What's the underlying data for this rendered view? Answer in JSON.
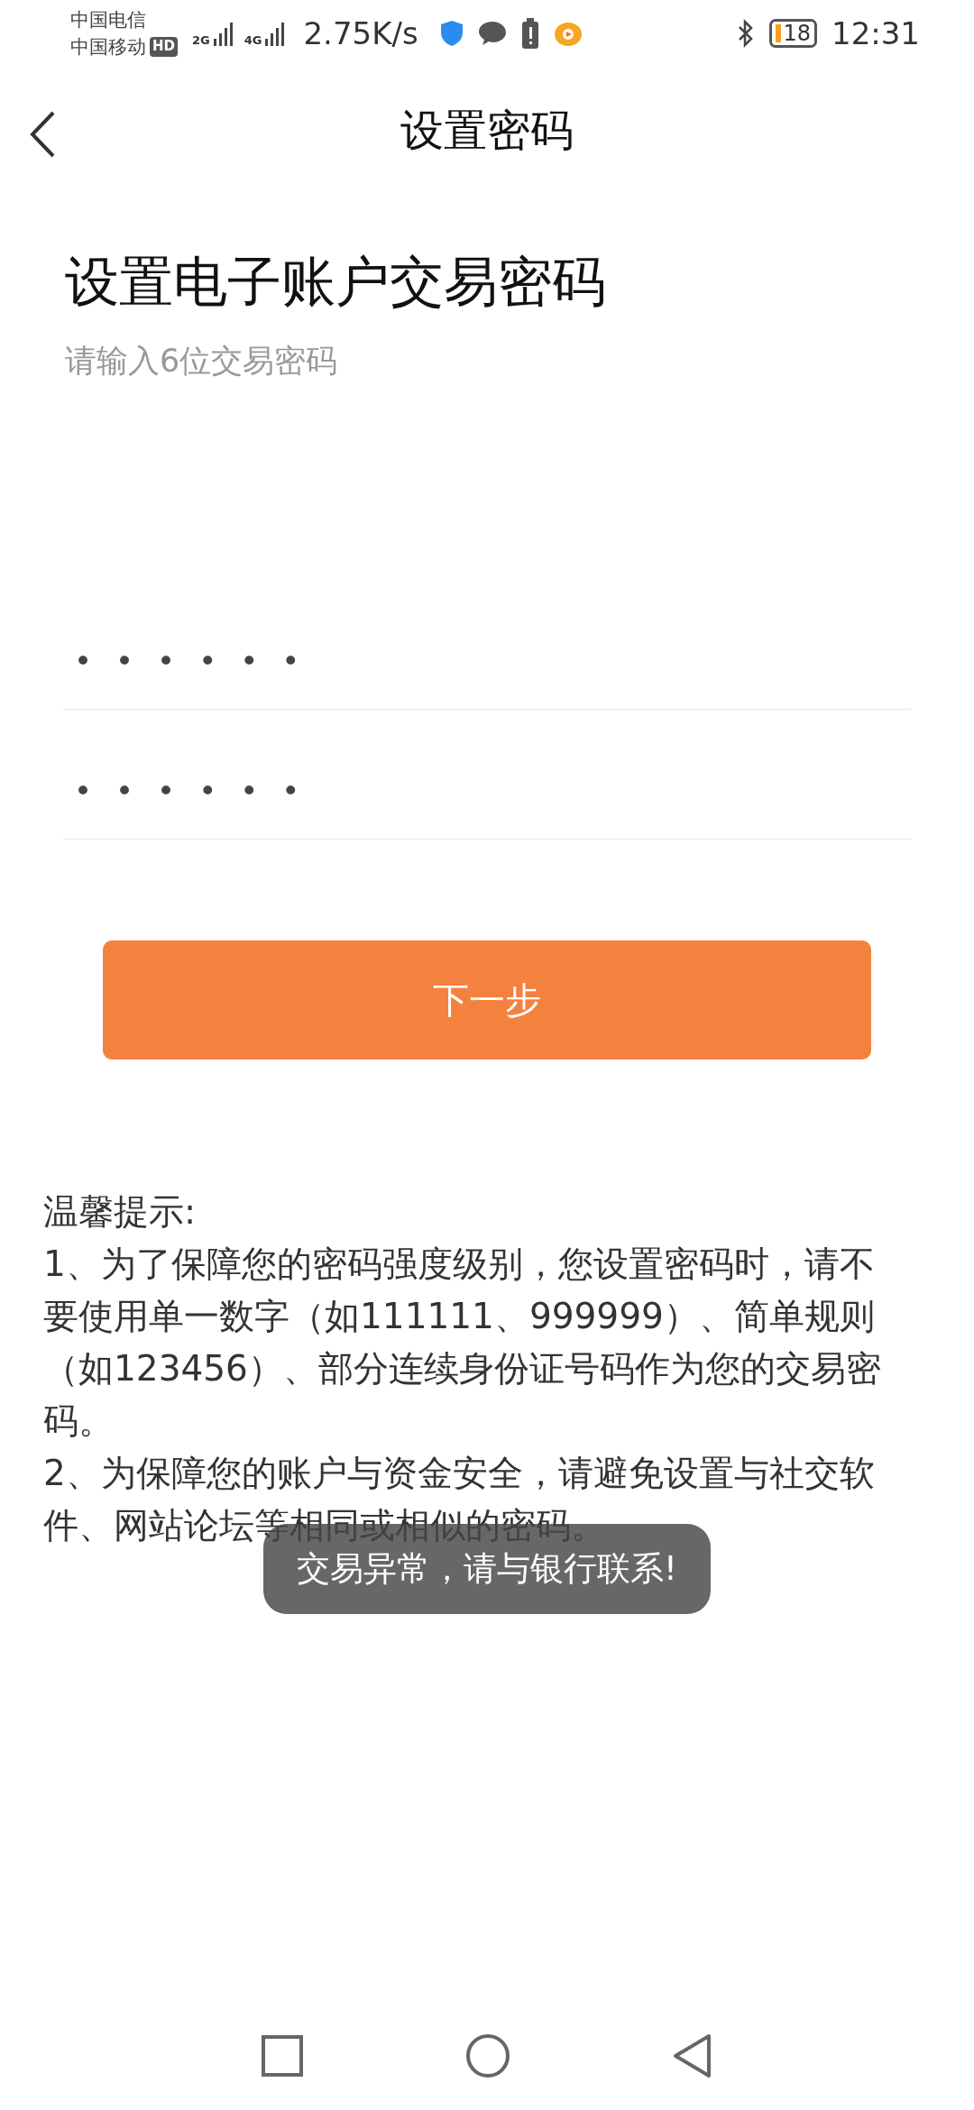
{
  "status_bar": {
    "carriers": [
      "中国电信",
      "中国移动"
    ],
    "hd_badge": "HD",
    "networks": [
      "2G",
      "4G"
    ],
    "speed": "2.75K/s",
    "battery": "18",
    "time": "12:31"
  },
  "nav": {
    "title": "设置密码"
  },
  "heading": "设置电子账户交易密码",
  "subtitle": "请输入6位交易密码",
  "fields": [
    {
      "value": "••••••"
    },
    {
      "value": "••••••"
    }
  ],
  "next_button": "下一步",
  "tips": {
    "title": "温馨提示:",
    "items": [
      "1、为了保障您的密码强度级别，您设置密码时，请不要使用单一数字（如111111、999999）、简单规则（如123456）、部分连续身份证号码作为您的交易密码。",
      "2、为保障您的账户与资金安全，请避免设置与社交软件、网站论坛等相同或相似的密码。"
    ]
  },
  "toast": "交易异常，请与银行联系!"
}
